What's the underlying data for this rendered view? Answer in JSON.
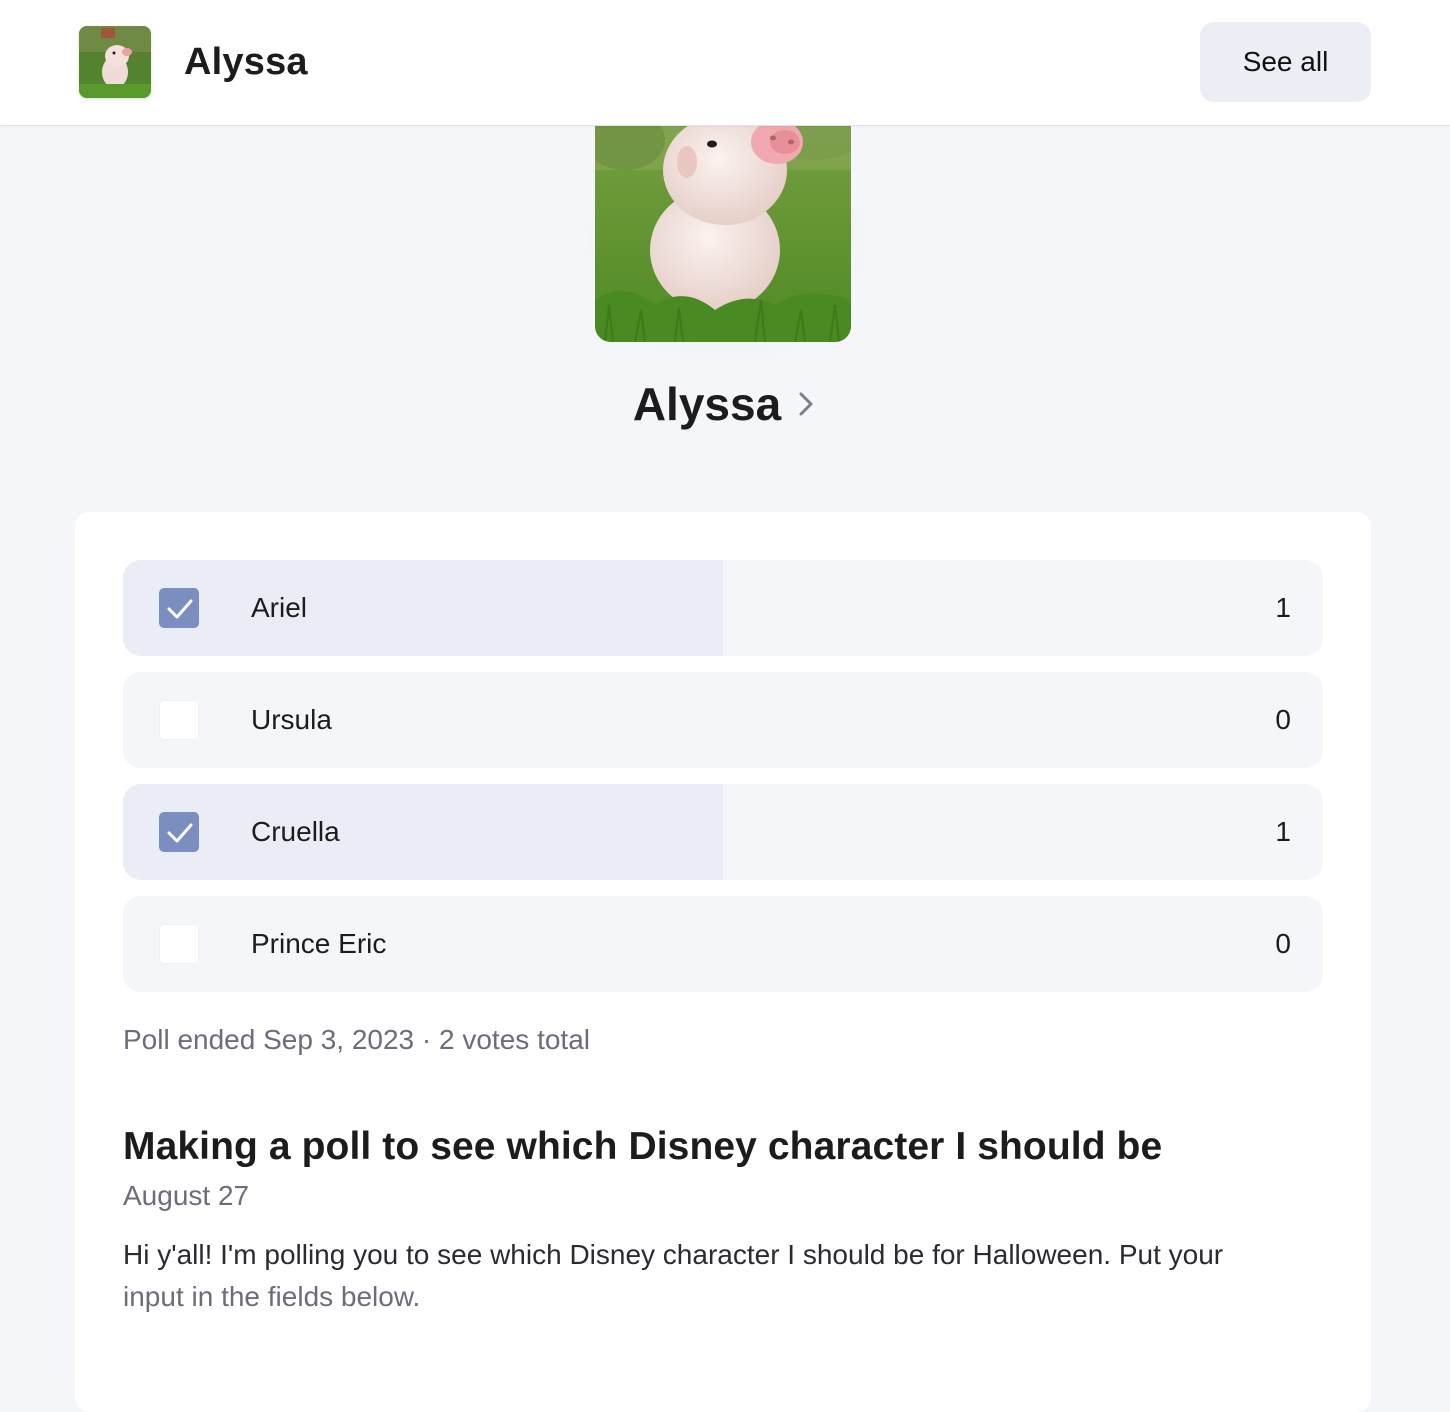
{
  "header": {
    "username": "Alyssa",
    "see_all_label": "See all"
  },
  "profile": {
    "name": "Alyssa",
    "avatar_icon": "piglet-photo",
    "chevron_icon": "chevron-right-icon"
  },
  "poll": {
    "options": [
      {
        "label": "Ariel",
        "votes": "1",
        "checked": true,
        "share": 0.5
      },
      {
        "label": "Ursula",
        "votes": "0",
        "checked": false,
        "share": 0
      },
      {
        "label": "Cruella",
        "votes": "1",
        "checked": true,
        "share": 0.5
      },
      {
        "label": "Prince Eric",
        "votes": "0",
        "checked": false,
        "share": 0
      }
    ],
    "meta": "Poll ended Sep 3, 2023 · 2 votes total"
  },
  "post": {
    "title": "Making a poll to see which Disney character I should be",
    "date": "August 27",
    "body_line1": "Hi y'all! I'm polling you to see which Disney character I should be for Halloween. Put your",
    "body_line2": "input in the fields below."
  },
  "colors": {
    "accent": "#7a8fc0",
    "fill": "#ebedf6",
    "row_bg": "#f5f6fa"
  }
}
